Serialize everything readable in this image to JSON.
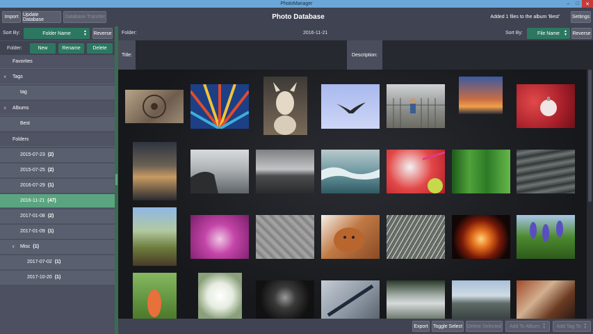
{
  "window": {
    "title": "PhotoManager"
  },
  "topbar": {
    "import": "Import",
    "update_database": "Update Database",
    "database_transfer": "Database Transfer",
    "app_title": "Photo Database",
    "status": "Added 1 files to the album 'Best'",
    "settings": "Settings"
  },
  "sidebar": {
    "sort_by_label": "Sort By:",
    "sort_value": "Folder Name",
    "reverse": "Reverse",
    "folder_label": "Folder:",
    "new": "New",
    "rename": "Rename",
    "delete": "Delete",
    "favorites": "Favorites",
    "tags_header": "Tags",
    "tag_item": "tag",
    "albums_header": "Albums",
    "album_best": "Best",
    "folders_header": "Folders",
    "folders": [
      {
        "name": "2015-07-23",
        "count": "(2)"
      },
      {
        "name": "2015-07-25",
        "count": "(2)"
      },
      {
        "name": "2016-07-29",
        "count": "(1)"
      },
      {
        "name": "2016-11-21",
        "count": "(47)"
      },
      {
        "name": "2017-01-08",
        "count": "(2)"
      },
      {
        "name": "2017-01-09",
        "count": "(1)"
      },
      {
        "name": "Misc",
        "count": "(1)"
      },
      {
        "name": "2017-07-02",
        "count": "(1)"
      },
      {
        "name": "2017-10-20",
        "count": "(1)"
      }
    ]
  },
  "main": {
    "folder_label": "Folder:",
    "folder_value": "2016-11-21",
    "sort_by_label": "Sort By:",
    "sort_value": "File Name",
    "reverse": "Reverse",
    "title_label": "Title:",
    "description_label": "Description:"
  },
  "bottombar": {
    "export": "Export",
    "toggle_select": "Toggle Select",
    "delete_selected": "Delete Selected",
    "add_to_album": "Add To Album",
    "add_tag_to": "Add Tag To"
  },
  "colors": {
    "accent_green": "#2d7761",
    "selected_row": "#5aa57f",
    "titlebar": "#6aa7d8"
  },
  "icons": {
    "expand": "chevron-down-icon",
    "select_arrows": "updown-arrows-icon"
  }
}
